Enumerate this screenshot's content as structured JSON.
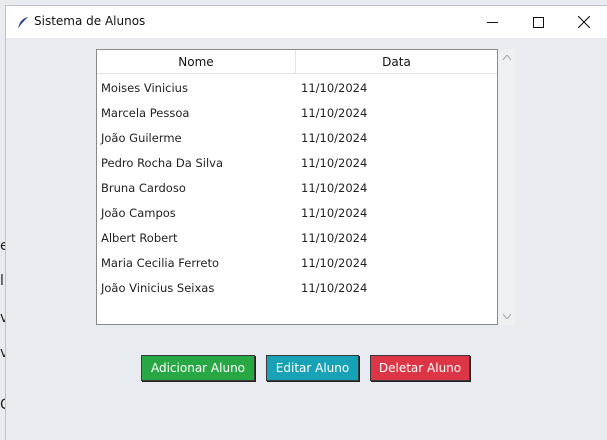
{
  "window": {
    "title": "Sistema de Alunos"
  },
  "background_fragments": [
    "e",
    "l",
    "v",
    "v",
    "C"
  ],
  "table": {
    "columns": [
      "Nome",
      "Data"
    ],
    "rows": [
      {
        "nome": "Moises Vinicius",
        "data": "11/10/2024"
      },
      {
        "nome": "Marcela Pessoa",
        "data": "11/10/2024"
      },
      {
        "nome": "João Guilerme",
        "data": "11/10/2024"
      },
      {
        "nome": "Pedro Rocha Da Silva",
        "data": "11/10/2024"
      },
      {
        "nome": "Bruna Cardoso",
        "data": "11/10/2024"
      },
      {
        "nome": "João Campos",
        "data": "11/10/2024"
      },
      {
        "nome": "Albert Robert",
        "data": "11/10/2024"
      },
      {
        "nome": "Maria Cecilia Ferreto",
        "data": "11/10/2024"
      },
      {
        "nome": "João Vinicius Seixas",
        "data": "11/10/2024"
      }
    ]
  },
  "buttons": {
    "add": "Adicionar Aluno",
    "edit": "Editar Aluno",
    "delete": "Deletar Aluno"
  },
  "colors": {
    "add": "#28a745",
    "edit": "#17a2b8",
    "delete": "#dc3545"
  },
  "icons": {
    "app": "feather-icon",
    "minimize": "minimize-icon",
    "maximize": "maximize-icon",
    "close": "close-icon"
  }
}
